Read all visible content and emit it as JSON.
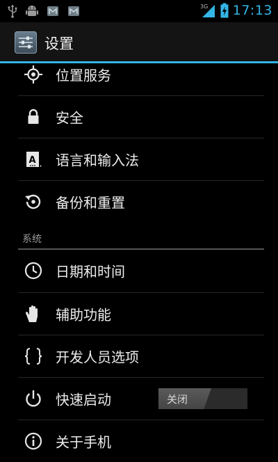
{
  "status_bar": {
    "time": "17:13",
    "network_type": "3G",
    "icons": [
      "usb-icon",
      "android-debug-icon",
      "gmail-icon",
      "gmail-icon",
      "signal-icon",
      "battery-charging-icon"
    ]
  },
  "action_bar": {
    "title": "设置",
    "icon": "settings-app-icon",
    "accent_color": "#33b5e5"
  },
  "items_top": [
    {
      "label": "位置服务",
      "icon": "location-icon"
    },
    {
      "label": "安全",
      "icon": "lock-icon"
    },
    {
      "label": "语言和输入法",
      "icon": "keyboard-language-icon"
    },
    {
      "label": "备份和重置",
      "icon": "backup-restore-icon"
    }
  ],
  "section": {
    "header": "系统"
  },
  "items_system": [
    {
      "label": "日期和时间",
      "icon": "clock-icon"
    },
    {
      "label": "辅助功能",
      "icon": "hand-icon"
    },
    {
      "label": "开发人员选项",
      "icon": "braces-icon"
    },
    {
      "label": "快速启动",
      "icon": "power-icon",
      "toggle": {
        "state_label": "关闭",
        "value": "off"
      }
    },
    {
      "label": "关于手机",
      "icon": "info-icon"
    }
  ]
}
